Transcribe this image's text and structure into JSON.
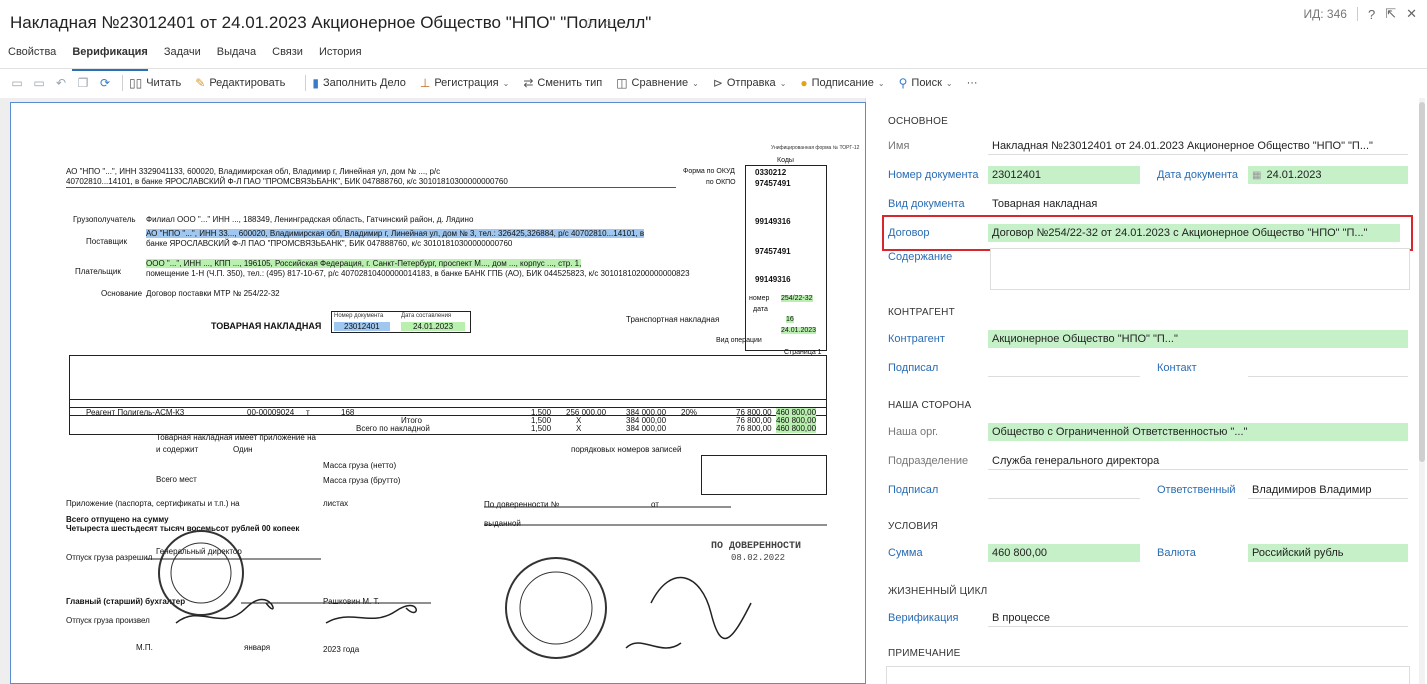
{
  "header": {
    "title": "Накладная №23012401 от 24.01.2023 Акционерное Общество \"НПО\" \"Полицелл\"",
    "id_label": "ИД: 346"
  },
  "tabs": [
    {
      "label": "Свойства"
    },
    {
      "label": "Верификация",
      "active": true
    },
    {
      "label": "Задачи"
    },
    {
      "label": "Выдача"
    },
    {
      "label": "Связи"
    },
    {
      "label": "История"
    }
  ],
  "toolbar": {
    "read": "Читать",
    "edit": "Редактировать",
    "fill_case": "Заполнить Дело",
    "registration": "Регистрация",
    "change_type": "Сменить тип",
    "compare": "Сравнение",
    "send": "Отправка",
    "sign": "Подписание",
    "search": "Поиск",
    "more": "···"
  },
  "form": {
    "basic": {
      "section": "ОСНОВНОЕ",
      "name_label": "Имя",
      "name_value": "Накладная №23012401 от 24.01.2023 Акционерное Общество \"НПО\" \"П...\"",
      "docnum_label": "Номер документа",
      "docnum_value": "23012401",
      "docdate_label": "Дата документа",
      "docdate_value": "24.01.2023",
      "doctype_label": "Вид документа",
      "doctype_value": "Товарная накладная",
      "contract_label": "Договор",
      "contract_value": "Договор №254/22-32 от 24.01.2023 с Акционерное Общество \"НПО\" \"П...\"",
      "content_label": "Содержание"
    },
    "counterparty": {
      "section": "КОНТРАГЕНТ",
      "cp_label": "Контрагент",
      "cp_value": "Акционерное Общество \"НПО\" \"П...\"",
      "signed_label": "Подписал",
      "contact_label": "Контакт"
    },
    "our_side": {
      "section": "НАША СТОРОНА",
      "org_label": "Наша орг.",
      "org_value": "Общество с Ограниченной Ответственностью \"...\"",
      "dept_label": "Подразделение",
      "dept_value": "Служба генерального директора",
      "signed_label": "Подписал",
      "resp_label": "Ответственный",
      "resp_value": "Владимиров Владимир"
    },
    "terms": {
      "section": "УСЛОВИЯ",
      "sum_label": "Сумма",
      "sum_value": "460 800,00",
      "currency_label": "Валюта",
      "currency_value": "Российский рубль"
    },
    "lifecycle": {
      "section": "ЖИЗНЕННЫЙ ЦИКЛ",
      "verif_label": "Верификация",
      "verif_value": "В процессе"
    },
    "note": {
      "section": "ПРИМЕЧАНИЕ"
    }
  },
  "scan": {
    "form_code": "Унифицированная форма № ТОРГ-12",
    "supplier_line": "АО \"НПО \"...\", ИНН 3329041133, 600020, Владимирская обл, Владимир г, Линейная ул, дом № ..., р/с",
    "account_line": "40702810...14101, в банке ЯРОСЛАВСКИЙ Ф-Л ПАО \"ПРОМСВЯЗЬБАНК\", БИК 047888760, к/с 30101810300000000760",
    "codes_header": "Коды",
    "okud_label": "Форма по ОКУД",
    "okud_value": "0330212",
    "okpo_label": "по ОКПО",
    "okpo1": "97457491",
    "okpo2": "99149316",
    "okpo3": "97457491",
    "okpo4": "99149316",
    "consignee_label": "Грузополучатель",
    "consignee_value": "Филиал ООО \"...\" ИНН ..., 188349, Ленинградская область, Гатчинский район, д. Лядино",
    "supplier_label": "Поставщик",
    "supplier_value": "АО \"НПО \"...\", ИНН 33..., 600020, Владимирская обл, Владимир г, Линейная ул, дом № 3, тел.: 326425,326884, р/с 40702810...14101, в",
    "supplier_bank": "банке ЯРОСЛАВСКИЙ Ф-Л ПАО \"ПРОМСВЯЗЬБАНК\", БИК 047888760, к/с 30101810300000000760",
    "payer_label": "Плательщик",
    "payer_value": "ООО \"...\", ИНН ..., КПП ..., 196105, Российская Федерация, г. Санкт-Петербург, проспект М..., дом ..., корпус ..., стр. 1,",
    "payer_value2": "помещение 1-Н (Ч.П. 350), тел.: (495) 817-10-67, р/с 40702810400000014183, в банке БАНК ГПБ (АО), БИК 044525823, к/с 30101810200000000823",
    "basis_label": "Основание",
    "basis_value": "Договор поставки МТР № 254/22-32",
    "number_label": "номер",
    "number_value": "254/22-32",
    "date_label": "дата",
    "transport_label": "Транспортная накладная",
    "tn_number": "16",
    "tn_date": "24.01.2023",
    "op_kind": "Вид операции",
    "doc_title": "ТОВАРНАЯ НАКЛАДНАЯ",
    "docnum_head": "Номер документа",
    "docdate_head": "Дата составления",
    "docnum": "23012401",
    "docdate": "24.01.2023",
    "page": "Страница 1",
    "product": "Реагент Полигель-АСМ-К3",
    "product_code": "00-00009024",
    "unit": "т",
    "okei": "168",
    "qty": "1,500",
    "price": "256 000,00",
    "sum_wo_vat": "384 000,00",
    "vat_rate": "20%",
    "vat_sum": "76 800,00",
    "total": "460 800,00",
    "itogo": "Итого",
    "total_by": "Всего по накладной",
    "x_mark": "X",
    "appendix": "Товарная накладная имеет приложение на",
    "contains": "и содержит",
    "one": "Один",
    "serial_records": "порядковых номеров записей",
    "mass_net": "Масса груза (нетто)",
    "mass_gross": "Масса груза (брутто)",
    "total_places": "Всего мест",
    "attachment": "Приложение (паспорта, сертификаты и т.п.) на",
    "sheets": "листах",
    "power_of_attorney": "По доверенности №",
    "from": "от",
    "issued": "выданной",
    "released_sum": "Всего отпущено  на сумму",
    "released_words": "Четыреста шестьдесят тысяч восемьсот рублей 00 копеек",
    "release_allowed": "Отпуск груза разрешил",
    "gen_director": "Генеральный директор",
    "chief_acc": "Главный (старший) бухгалтер",
    "released_by": "Отпуск груза произвел",
    "mp": "М.П.",
    "january": "января",
    "year_2023": "2023 года",
    "stamp_text": "ПО ДОВЕРЕННОСТИ",
    "stamp_date": "08.02.2022",
    "manager": "Рашковин М. Т."
  }
}
